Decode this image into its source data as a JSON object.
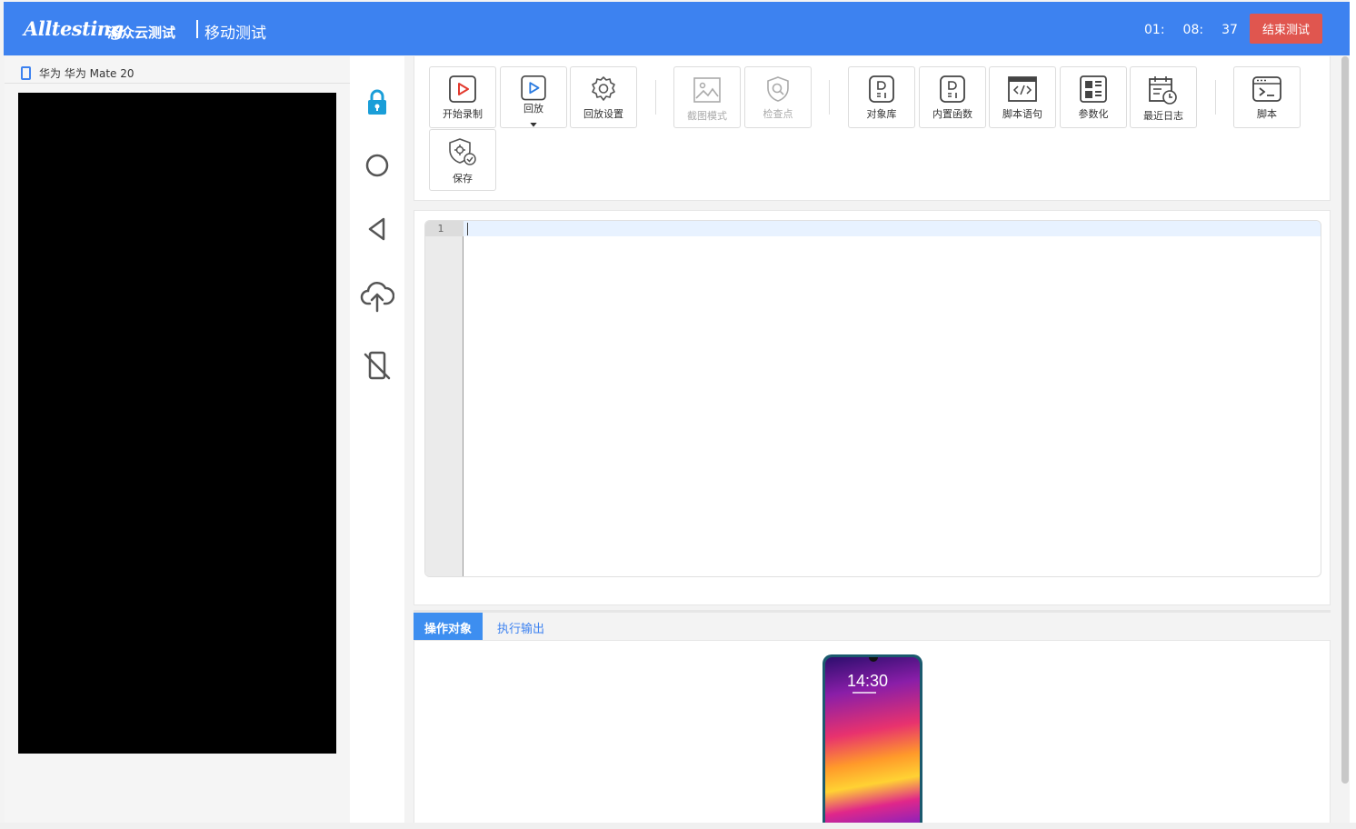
{
  "header": {
    "logo": "Alltesting",
    "brand": "泽众云测试",
    "section": "移动测试",
    "timer": [
      "01:",
      "08:",
      "37"
    ],
    "end_button": "结束测试",
    "accent": "#3d82f0"
  },
  "device": {
    "name": "华为 华为 Mate 20"
  },
  "controls": [
    {
      "name": "lock",
      "icon": "lock-icon"
    },
    {
      "name": "home",
      "icon": "circle-icon"
    },
    {
      "name": "back",
      "icon": "triangle-back-icon"
    },
    {
      "name": "upload",
      "icon": "cloud-upload-icon"
    },
    {
      "name": "disconnect",
      "icon": "phone-disabled-icon"
    }
  ],
  "toolbar": {
    "start_record": "开始录制",
    "playback": "回放",
    "playback_settings": "回放设置",
    "screenshot_mode": "截图模式",
    "checkpoint": "检查点",
    "object_library": "对象库",
    "builtin_functions": "内置函数",
    "script_statement": "脚本语句",
    "parameterize": "参数化",
    "recent_logs": "最近日志",
    "script": "脚本",
    "save": "保存"
  },
  "editor": {
    "line_numbers": [
      "1"
    ]
  },
  "bottom_tabs": {
    "objects": "操作对象",
    "output": "执行输出"
  },
  "preview": {
    "clock": "14:30"
  }
}
